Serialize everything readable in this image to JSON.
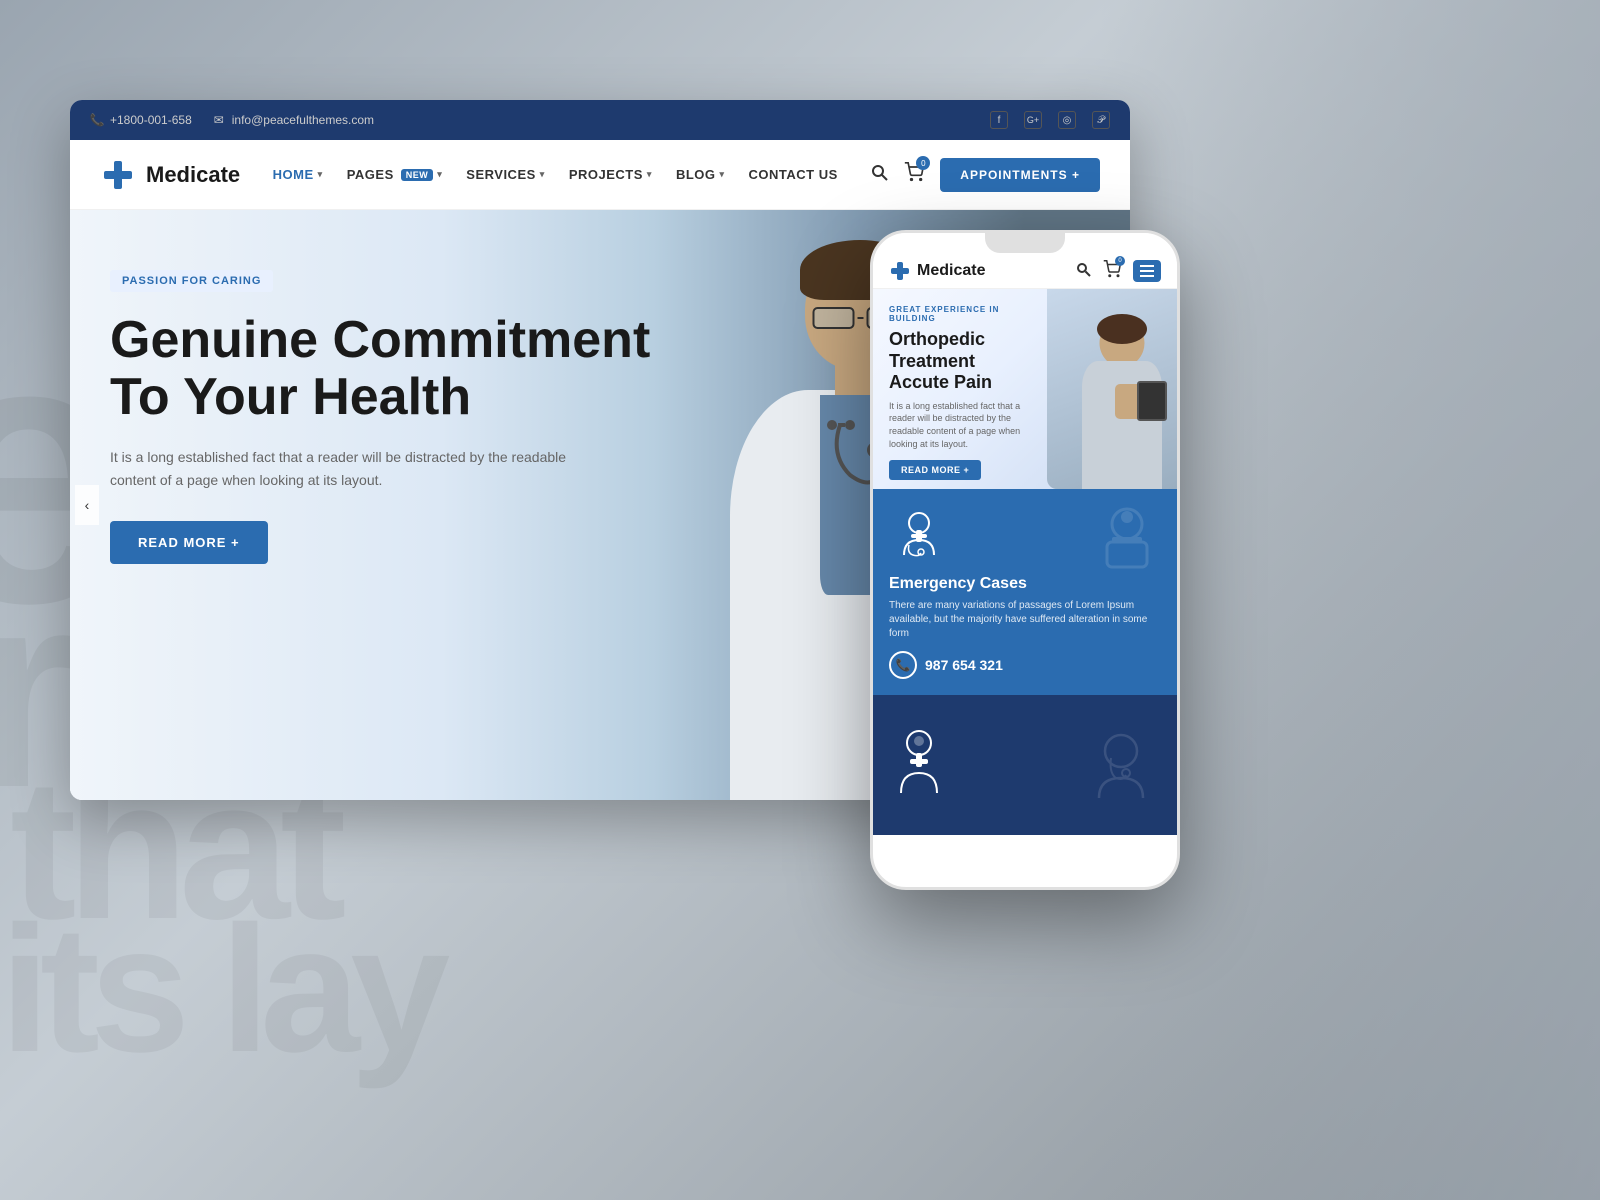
{
  "background": {
    "text1": "e",
    "text2": "r",
    "text3": "that",
    "text4": "its lay"
  },
  "topbar": {
    "phone": "+1800-001-658",
    "email": "info@peacefulthemes.com",
    "phone_icon": "📞",
    "email_icon": "✉",
    "social": [
      "f",
      "G+",
      "📷",
      "📌"
    ]
  },
  "navbar": {
    "logo_text": "Medicate",
    "nav_items": [
      {
        "label": "HOME",
        "has_dropdown": true,
        "active": true
      },
      {
        "label": "PAGES",
        "badge": "New",
        "has_dropdown": true
      },
      {
        "label": "SERVICES",
        "has_dropdown": true
      },
      {
        "label": "PROJECTS",
        "has_dropdown": true
      },
      {
        "label": "BLOG",
        "has_dropdown": true
      },
      {
        "label": "CONTACT US",
        "has_dropdown": false
      }
    ],
    "appointments_label": "APPOINTMENTS +",
    "cart_count": "0"
  },
  "hero": {
    "badge": "PASSION FOR CARING",
    "title_line1": "Genuine Commitment",
    "title_line2": "To Your Health",
    "description": "It is a long established fact that a reader will be distracted by the readable content of a page when looking at its layout.",
    "cta_label": "READ MORE  +"
  },
  "mobile": {
    "logo_text": "Medicate",
    "hero": {
      "label": "GREAT EXPERIENCE IN BUILDING",
      "title": "Orthopedic Treatment Accute Pain",
      "description": "It is a long established fact that a reader will be distracted by the readable content of a page when looking at its layout.",
      "cta": "READ MORE +"
    },
    "emergency": {
      "title": "Emergency Cases",
      "description": "There are many variations of passages of Lorem Ipsum available, but the majority have suffered alteration in some form",
      "phone": "987 654 321"
    }
  }
}
